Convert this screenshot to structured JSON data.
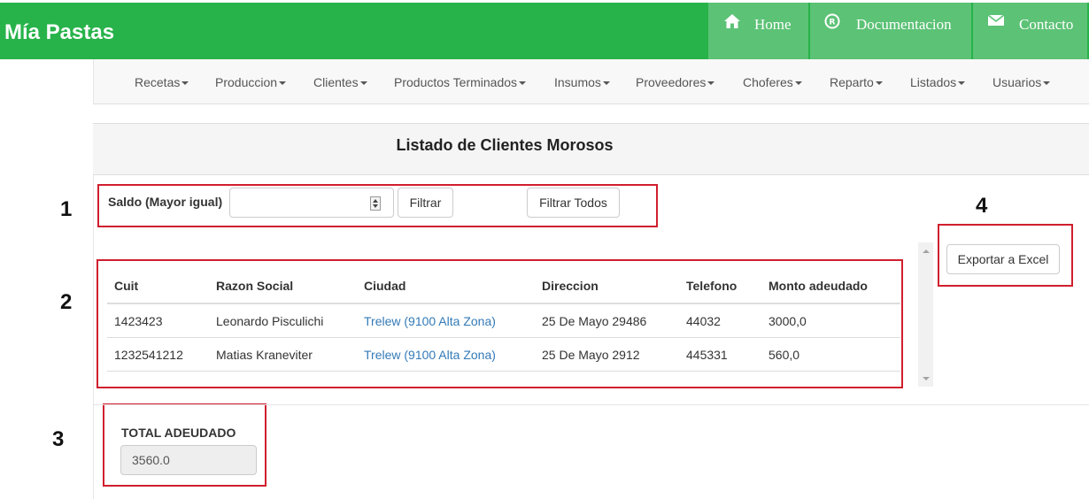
{
  "header": {
    "brand": "Mía Pastas",
    "nav": [
      {
        "label": "Home",
        "icon": "home-icon"
      },
      {
        "label": "Documentacion",
        "icon": "registered-icon"
      },
      {
        "label": "Contacto",
        "icon": "envelope-icon"
      }
    ]
  },
  "menu": [
    "Recetas",
    "Produccion",
    "Clientes",
    "Productos Terminados",
    "Insumos",
    "Proveedores",
    "Choferes",
    "Reparto",
    "Listados",
    "Usuarios"
  ],
  "panel": {
    "title": "Listado de Clientes Morosos"
  },
  "filter": {
    "saldo_label": "Saldo (Mayor igual)",
    "saldo_value": "",
    "filtrar_label": "Filtrar",
    "filtrar_todos_label": "Filtrar Todos"
  },
  "export": {
    "label": "Exportar a Excel"
  },
  "table": {
    "columns": [
      "Cuit",
      "Razon Social",
      "Ciudad",
      "Direccion",
      "Telefono",
      "Monto adeudado"
    ],
    "rows": [
      [
        "1423423",
        "Leonardo Pisculichi",
        "Trelew (9100 Alta Zona)",
        "25 De Mayo 29486",
        "44032",
        "3000,0"
      ],
      [
        "1232541212",
        "Matias Kraneviter",
        "Trelew (9100 Alta Zona)",
        "25 De Mayo 2912",
        "445331",
        "560,0"
      ]
    ]
  },
  "total": {
    "label": "TOTAL ADEUDADO",
    "value": "3560.0"
  },
  "annotations": [
    "1",
    "2",
    "3",
    "4"
  ],
  "colors": {
    "header_green": "#27b34a",
    "nav_tab": "#5cc276",
    "highlight_red": "#d01f2e",
    "link_blue": "#337ab7"
  }
}
